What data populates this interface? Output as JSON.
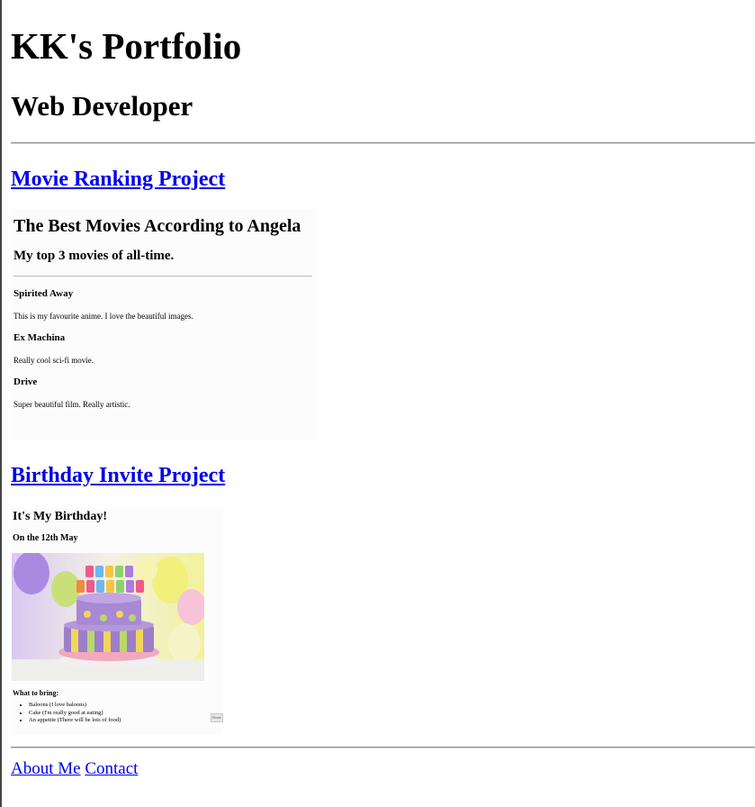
{
  "header": {
    "title": "KK's Portfolio",
    "subtitle": "Web Developer"
  },
  "projects": [
    {
      "link": "Movie Ranking Project",
      "preview": {
        "title": "The Best Movies According to Angela",
        "subtitle": "My top 3 movies of all-time.",
        "movies": [
          {
            "name": "Spirited Away",
            "description": "This is my favourite anime. I love the beautiful images."
          },
          {
            "name": "Ex Machina",
            "description": "Really cool sci-fi movie."
          },
          {
            "name": "Drive",
            "description": "Super beautiful film. Really artistic."
          }
        ]
      }
    },
    {
      "link": "Birthday Invite Project",
      "preview": {
        "title": "It's My Birthday!",
        "subtitle": "On the 12th May",
        "what_to_bring": "What to bring:",
        "items": [
          "Baloons (I love baloons)",
          "Cake (I'm really good at eating)",
          "An appetite (There will be lots of food)"
        ],
        "button": "Route"
      }
    }
  ],
  "footer": {
    "about": "About Me",
    "contact": "Contact"
  },
  "colors": {
    "link": "#0000ee",
    "rule": "#8a8a8a"
  }
}
